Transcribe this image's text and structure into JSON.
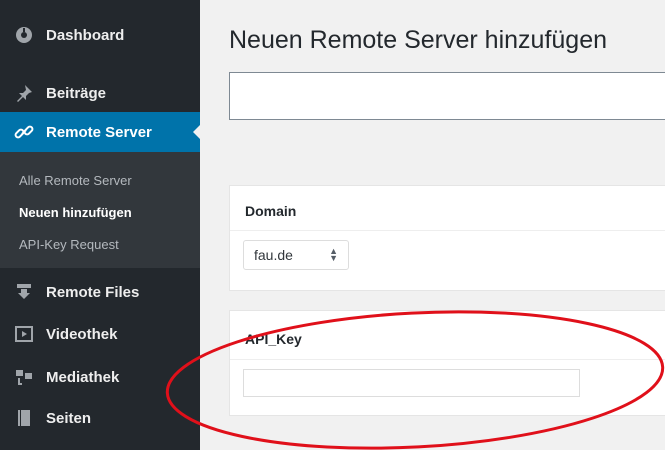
{
  "sidebar": {
    "items": [
      {
        "label": "Dashboard",
        "icon": "dashboard-icon"
      },
      {
        "label": "Beiträge",
        "icon": "pin-icon"
      },
      {
        "label": "Remote Server",
        "icon": "link-icon"
      },
      {
        "label": "Remote Files",
        "icon": "download-icon"
      },
      {
        "label": "Videothek",
        "icon": "video-icon"
      },
      {
        "label": "Mediathek",
        "icon": "media-icon"
      },
      {
        "label": "Seiten",
        "icon": "page-icon"
      }
    ],
    "submenu": [
      "Alle Remote Server",
      "Neuen hinzufügen",
      "API-Key Request"
    ]
  },
  "main": {
    "title": "Neuen Remote Server hinzufügen",
    "title_input_value": "",
    "domain": {
      "label": "Domain",
      "selected": "fau.de"
    },
    "api_key": {
      "label": "API_Key",
      "value": ""
    }
  },
  "colors": {
    "sidebar": "#23282d",
    "active": "#0073aa",
    "annotation": "#e0101a"
  }
}
